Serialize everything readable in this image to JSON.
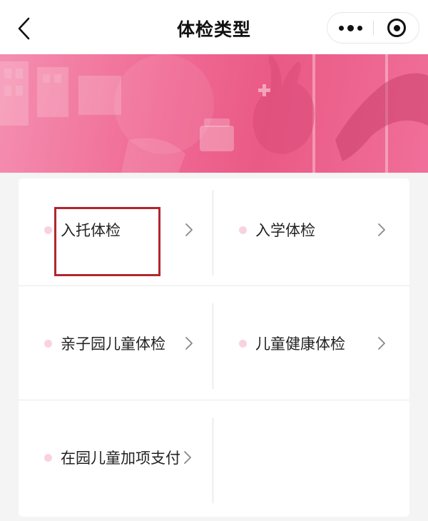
{
  "navbar": {
    "title": "体检类型"
  },
  "menu": {
    "items": [
      {
        "label": "入托体检",
        "row": 0,
        "col": 0
      },
      {
        "label": "入学体检",
        "row": 0,
        "col": 1
      },
      {
        "label": "亲子园儿童体检",
        "row": 1,
        "col": 0
      },
      {
        "label": "儿童健康体检",
        "row": 1,
        "col": 1
      },
      {
        "label": "在园儿童加项支付",
        "row": 2,
        "col": 0
      }
    ]
  },
  "colors": {
    "banner_pink": "#f06a95",
    "dot_pink": "#f8d3df",
    "highlight_red": "#b3262f"
  },
  "icons": {
    "back": "chevron-left-icon",
    "more": "more-dots-icon",
    "close": "target-icon",
    "item_arrow": "chevron-right-icon"
  }
}
